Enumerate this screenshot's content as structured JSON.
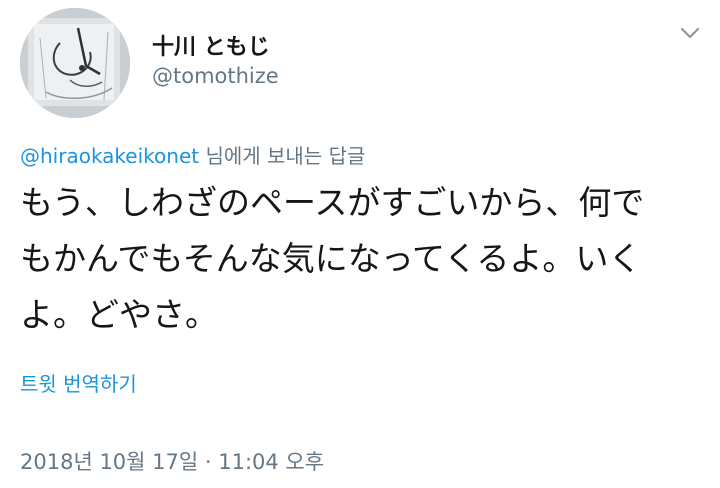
{
  "header": {
    "display_name": "十川 ともじ",
    "handle": "@tomothize"
  },
  "reply": {
    "mention": "@hiraokakeikonet",
    "suffix": " 님에게 보내는 답글"
  },
  "tweet": {
    "lines": [
      "もう、しわざのペースがすごいから、何で",
      "もかんでもそんな気になってくるよ。いく",
      "よ。どやさ。"
    ]
  },
  "translate_label": "트윗 번역하기",
  "timestamp": "2018년 10월 17일 · 11:04 오후",
  "icons": {
    "avatar": "profile-avatar",
    "menu": "chevron-down-icon"
  },
  "colors": {
    "link": "#1b95e0",
    "secondary_text": "#657786",
    "primary_text": "#14171a"
  }
}
